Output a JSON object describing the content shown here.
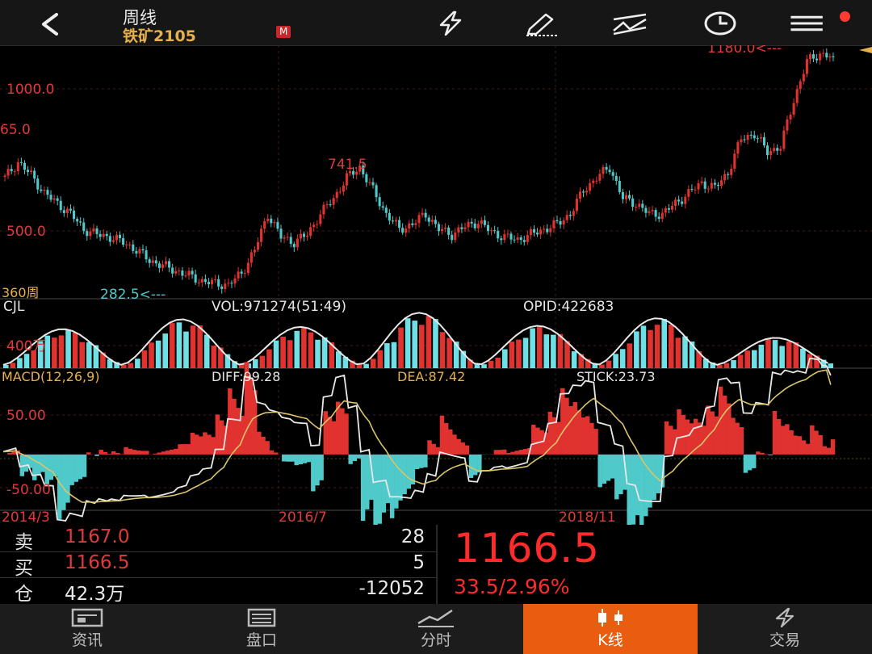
{
  "header": {
    "title": "周线",
    "instrument": "铁矿2105",
    "badge": "M",
    "icons": [
      "back-arrow-icon",
      "lightning-icon",
      "draw-icon",
      "indicator-icon",
      "clock-icon",
      "menu-icon"
    ]
  },
  "price_panel": {
    "price_labels": [
      "1000.0",
      "65.0",
      "500.0"
    ],
    "high_label": "741.5",
    "low_label": "282.5<---",
    "current_label": "1180.0<---",
    "period_label": "360周"
  },
  "volume_panel": {
    "name": "CJL",
    "vol_text": "VOL:971274(51:49)",
    "opid_text": "OPID:422683",
    "scale_label": "400万"
  },
  "macd_panel": {
    "name": "MACD(12,26,9)",
    "diff_text": "DIFF:99.28",
    "dea_text": "DEA:87.42",
    "stick_text": "STICK:23.73",
    "upper_label": "50.00",
    "lower_label": "-50.00"
  },
  "x_axis": {
    "labels": [
      "2014/3",
      "2016/7",
      "2018/11"
    ]
  },
  "quote": {
    "sell_label": "卖",
    "sell_price": "1167.0",
    "sell_qty": "28",
    "buy_label": "买",
    "buy_price": "1166.5",
    "buy_qty": "5",
    "oi_label": "仓",
    "oi_value": "42.3万",
    "oi_change": "-12052",
    "last_price": "1166.5",
    "change": "33.5/2.96%"
  },
  "nav": [
    {
      "label": "资讯",
      "icon": "news-icon",
      "active": false
    },
    {
      "label": "盘口",
      "icon": "orderbook-icon",
      "active": false
    },
    {
      "label": "分时",
      "icon": "timeshare-icon",
      "active": false
    },
    {
      "label": "K线",
      "icon": "candlestick-icon",
      "active": true
    },
    {
      "label": "交易",
      "icon": "trade-icon",
      "active": false
    }
  ],
  "colors": {
    "up": "#e0322f",
    "down": "#4fc9c9",
    "accent": "#e85d10",
    "gold": "#e6b04a"
  },
  "chart_data": {
    "type": "candlestick",
    "period": "weekly",
    "x_labels": [
      "2014/3",
      "2016/7",
      "2018/11"
    ],
    "price_series_approx": [
      {
        "name": "close",
        "values": [
          700,
          760,
          710,
          640,
          600,
          560,
          500,
          480,
          470,
          450,
          420,
          380,
          360,
          340,
          320,
          300,
          290,
          285,
          330,
          420,
          560,
          470,
          450,
          480,
          560,
          620,
          700,
          741,
          650,
          560,
          500,
          520,
          560,
          500,
          480,
          510,
          530,
          490,
          470,
          460,
          480,
          500,
          520,
          560,
          650,
          700,
          740,
          620,
          600,
          560,
          560,
          600,
          640,
          680,
          660,
          720,
          850,
          870,
          800,
          820,
          1000,
          1150,
          1180,
          1166
        ]
      }
    ],
    "volume_peaks_approx": [
      {
        "period": "2014",
        "value": 330
      },
      {
        "period": "2015",
        "value": 420
      },
      {
        "period": "2016",
        "value": 350
      },
      {
        "period": "2017",
        "value": 480
      },
      {
        "period": "2018",
        "value": 360
      },
      {
        "period": "2019",
        "value": 430
      },
      {
        "period": "2020",
        "value": 250
      }
    ],
    "macd": {
      "diff": 99.28,
      "dea": 87.42,
      "stick": 23.73,
      "ylim": [
        -70,
        90
      ]
    }
  }
}
